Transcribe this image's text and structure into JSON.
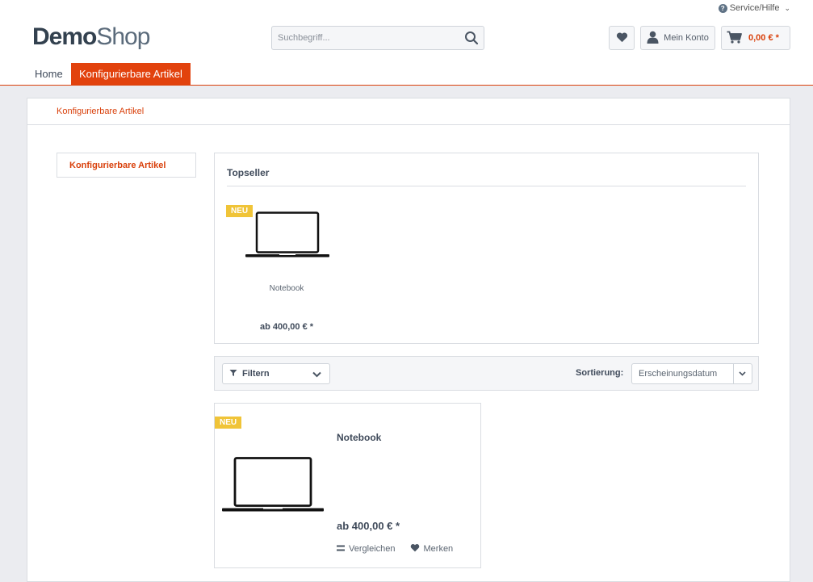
{
  "header": {
    "service_label": "Service/Hilfe",
    "logo_bold": "Demo",
    "logo_regular": "Shop",
    "search_placeholder": "Suchbegriff...",
    "account_label": "Mein Konto",
    "cart_amount": "0,00 € *"
  },
  "nav": {
    "items": [
      {
        "label": "Home"
      },
      {
        "label": "Konfigurierbare Artikel",
        "active": true
      }
    ]
  },
  "breadcrumb": "Konfigurierbare Artikel",
  "sidebar": {
    "items": [
      {
        "label": "Konfigurierbare Artikel"
      }
    ]
  },
  "topseller": {
    "title": "Topseller",
    "product": {
      "badge": "NEU",
      "name": "Notebook",
      "price": "ab 400,00 € *"
    }
  },
  "listing": {
    "filter_label": "Filtern",
    "sort_label": "Sortierung:",
    "sort_value": "Erscheinungsdatum",
    "product": {
      "badge": "NEU",
      "name": "Notebook",
      "price": "ab 400,00 € *",
      "compare_label": "Vergleichen",
      "remember_label": "Merken"
    }
  },
  "colors": {
    "accent": "#e2420d",
    "badge": "#f0c438"
  },
  "icons": [
    "question-icon",
    "chevron-down-icon",
    "search-icon",
    "heart-icon",
    "user-icon",
    "cart-icon",
    "filter-icon",
    "compare-icon",
    "laptop-icon"
  ]
}
